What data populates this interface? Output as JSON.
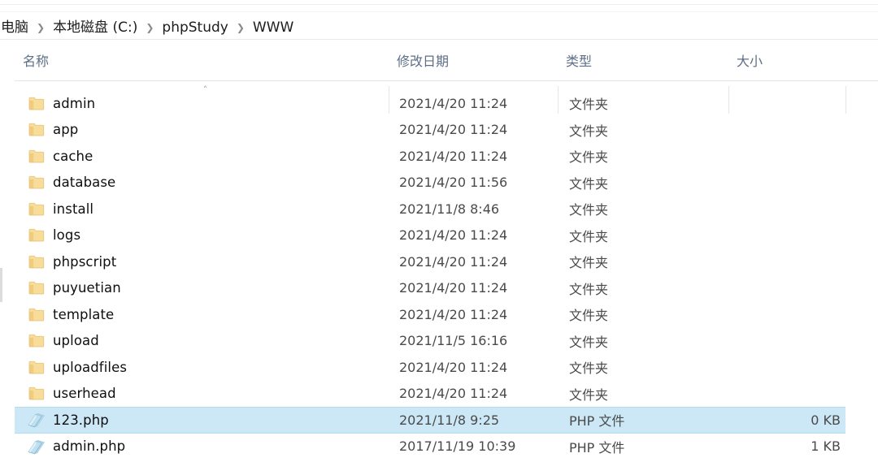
{
  "window": {
    "app": "Windows File Explorer",
    "breadcrumb": {
      "items": [
        "电脑",
        "本地磁盘 (C:)",
        "phpStudy",
        "WWW"
      ],
      "separator": "❯"
    }
  },
  "columns": {
    "headers": [
      "名称",
      "修改日期",
      "类型",
      "大小"
    ],
    "sort": {
      "column": "名称",
      "direction": "ascending",
      "glyph": "˄"
    }
  },
  "files": {
    "rows": [
      {
        "name": "admin",
        "icon": "folder-icon",
        "date": "2021/4/20 11:24",
        "type": "文件夹",
        "size": "",
        "selected": false
      },
      {
        "name": "app",
        "icon": "folder-icon",
        "date": "2021/4/20 11:24",
        "type": "文件夹",
        "size": "",
        "selected": false
      },
      {
        "name": "cache",
        "icon": "folder-icon",
        "date": "2021/4/20 11:24",
        "type": "文件夹",
        "size": "",
        "selected": false
      },
      {
        "name": "database",
        "icon": "folder-icon",
        "date": "2021/4/20 11:56",
        "type": "文件夹",
        "size": "",
        "selected": false
      },
      {
        "name": "install",
        "icon": "folder-icon",
        "date": "2021/11/8 8:46",
        "type": "文件夹",
        "size": "",
        "selected": false
      },
      {
        "name": "logs",
        "icon": "folder-icon",
        "date": "2021/4/20 11:24",
        "type": "文件夹",
        "size": "",
        "selected": false
      },
      {
        "name": "phpscript",
        "icon": "folder-icon",
        "date": "2021/4/20 11:24",
        "type": "文件夹",
        "size": "",
        "selected": false
      },
      {
        "name": "puyuetian",
        "icon": "folder-icon",
        "date": "2021/4/20 11:24",
        "type": "文件夹",
        "size": "",
        "selected": false
      },
      {
        "name": "template",
        "icon": "folder-icon",
        "date": "2021/4/20 11:24",
        "type": "文件夹",
        "size": "",
        "selected": false
      },
      {
        "name": "upload",
        "icon": "folder-icon",
        "date": "2021/11/5 16:16",
        "type": "文件夹",
        "size": "",
        "selected": false
      },
      {
        "name": "uploadfiles",
        "icon": "folder-icon",
        "date": "2021/4/20 11:24",
        "type": "文件夹",
        "size": "",
        "selected": false
      },
      {
        "name": "userhead",
        "icon": "folder-icon",
        "date": "2021/4/20 11:24",
        "type": "文件夹",
        "size": "",
        "selected": false
      },
      {
        "name": "123.php",
        "icon": "php-file-icon",
        "date": "2021/11/8 9:25",
        "type": "PHP 文件",
        "size": "0 KB",
        "selected": true
      },
      {
        "name": "admin.php",
        "icon": "php-file-icon",
        "date": "2017/11/19 10:39",
        "type": "PHP 文件",
        "size": "1 KB",
        "selected": false
      }
    ]
  },
  "colors": {
    "selection_fill": "#cce8f7",
    "selection_border": "#b5dcf0",
    "header_text": "#5d6f87",
    "folder_icon": "#f6d98f",
    "php_icon": "#a9d8ee",
    "row_text": "#0f0f0f",
    "meta_text": "#4a4a4a"
  },
  "layout": {
    "column_x": {
      "name": 18,
      "date": 478,
      "type": 686,
      "size": 896,
      "end": 1040
    }
  }
}
